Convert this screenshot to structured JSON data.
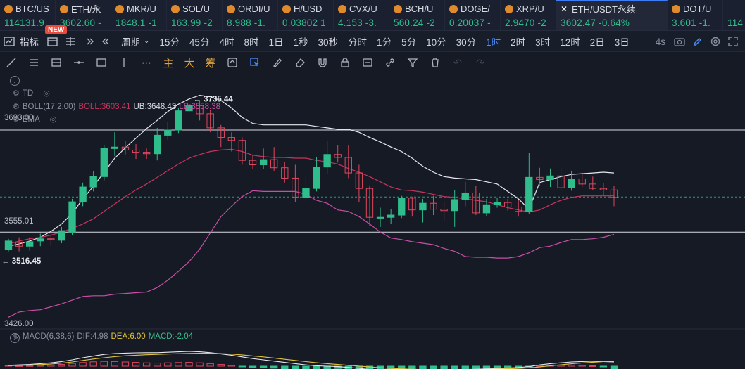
{
  "ticker": [
    {
      "symbol": "BTC/US",
      "price": "114131.9",
      "icon": "coin-icon"
    },
    {
      "symbol": "ETH/永",
      "price": "3602.60 -",
      "icon": "coin-icon"
    },
    {
      "symbol": "MKR/U",
      "price": "1848.1 -1",
      "icon": "coin-icon"
    },
    {
      "symbol": "SOL/U",
      "price": "163.99 -2",
      "icon": "coin-icon"
    },
    {
      "symbol": "ORDI/U",
      "price": "8.988 -1.",
      "icon": "coin-icon"
    },
    {
      "symbol": "H/USD",
      "price": "0.03802 1",
      "icon": "coin-icon"
    },
    {
      "symbol": "CVX/U",
      "price": "4.153 -3.",
      "icon": "coin-icon"
    },
    {
      "symbol": "BCH/U",
      "price": "560.24 -2",
      "icon": "coin-icon"
    },
    {
      "symbol": "DOGE/",
      "price": "0.20037 -",
      "icon": "coin-icon"
    },
    {
      "symbol": "XRP/U",
      "price": "2.9470 -2",
      "icon": "coin-icon"
    },
    {
      "symbol": "ETH/USDT永续",
      "price": "3602.47  -0.64%",
      "icon": "x-logo-icon",
      "active": true
    },
    {
      "symbol": "DOT/U",
      "price": "3.601 -1.",
      "icon": "coin-icon"
    },
    {
      "symbol": "",
      "price": "114",
      "icon": ""
    }
  ],
  "new_badge": "NEW",
  "toolbar": {
    "indicator": "指标",
    "period": "周期",
    "intervals": [
      "15分",
      "45分",
      "4时",
      "8时",
      "1日",
      "1秒",
      "30秒",
      "分时",
      "1分",
      "5分",
      "10分",
      "30分",
      "1时",
      "2时",
      "3时",
      "12时",
      "2日",
      "3日"
    ],
    "selected_interval": "1时",
    "countdown": "4s"
  },
  "drawbar": {
    "cn_tools": [
      "主",
      "大",
      "筹"
    ]
  },
  "legend": {
    "td": "TD",
    "boll_name": "BOLL(17,2.00)",
    "boll": "BOLL:3603.41",
    "ub": "UB:3648.43",
    "lb": "LB:3558.38",
    "ema": "EMA",
    "macd_name": "MACD(6,38,6)",
    "dif": "DIF:4.98",
    "dea": "DEA:6.00",
    "macd": "MACD:-2.04"
  },
  "chart_data": {
    "type": "candlestick",
    "price_labels": {
      "hline_top": "3693.00",
      "hline_bottom": "3555.01",
      "axis_bottom": "3426.00",
      "high": "3735.44",
      "low": "3516.45"
    },
    "ylim": [
      3426,
      3770
    ],
    "hlines": [
      3693.0,
      3555.01
    ],
    "current_price": 3602.47,
    "high_marker": 3735.44,
    "low_marker": 3516.45,
    "candles": [
      [
        3531,
        3543,
        3529,
        3546
      ],
      [
        3541,
        3536,
        3529,
        3548
      ],
      [
        3536,
        3542,
        3530,
        3548
      ],
      [
        3543,
        3546,
        3536,
        3553
      ],
      [
        3546,
        3545,
        3537,
        3556
      ],
      [
        3544,
        3557,
        3540,
        3562
      ],
      [
        3555,
        3596,
        3551,
        3600
      ],
      [
        3596,
        3616,
        3590,
        3622
      ],
      [
        3616,
        3630,
        3610,
        3637
      ],
      [
        3630,
        3668,
        3625,
        3673
      ],
      [
        3668,
        3670,
        3658,
        3690
      ],
      [
        3670,
        3666,
        3660,
        3678
      ],
      [
        3666,
        3663,
        3654,
        3674
      ],
      [
        3663,
        3661,
        3654,
        3668
      ],
      [
        3661,
        3686,
        3652,
        3696
      ],
      [
        3686,
        3693,
        3680,
        3704
      ],
      [
        3693,
        3719,
        3689,
        3723
      ],
      [
        3719,
        3726,
        3707,
        3736
      ],
      [
        3726,
        3715,
        3706,
        3732
      ],
      [
        3715,
        3696,
        3690,
        3720
      ],
      [
        3696,
        3683,
        3670,
        3700
      ],
      [
        3683,
        3679,
        3664,
        3690
      ],
      [
        3679,
        3652,
        3646,
        3683
      ],
      [
        3652,
        3646,
        3640,
        3660
      ],
      [
        3646,
        3653,
        3640,
        3668
      ],
      [
        3653,
        3642,
        3638,
        3670
      ],
      [
        3642,
        3628,
        3622,
        3650
      ],
      [
        3628,
        3602,
        3596,
        3646
      ],
      [
        3602,
        3614,
        3596,
        3632
      ],
      [
        3614,
        3643,
        3610,
        3656
      ],
      [
        3643,
        3660,
        3634,
        3678
      ],
      [
        3660,
        3656,
        3649,
        3673
      ],
      [
        3656,
        3635,
        3628,
        3672
      ],
      [
        3635,
        3614,
        3596,
        3646
      ],
      [
        3614,
        3575,
        3563,
        3618
      ],
      [
        3575,
        3575,
        3562,
        3588
      ],
      [
        3575,
        3578,
        3566,
        3586
      ],
      [
        3578,
        3601,
        3574,
        3604
      ],
      [
        3601,
        3585,
        3576,
        3603
      ],
      [
        3585,
        3594,
        3568,
        3600
      ],
      [
        3594,
        3586,
        3578,
        3604
      ],
      [
        3586,
        3584,
        3570,
        3596
      ],
      [
        3584,
        3599,
        3562,
        3612
      ],
      [
        3599,
        3608,
        3590,
        3623
      ],
      [
        3608,
        3581,
        3578,
        3618
      ],
      [
        3581,
        3592,
        3577,
        3600
      ],
      [
        3592,
        3595,
        3588,
        3602
      ],
      [
        3595,
        3589,
        3584,
        3600
      ],
      [
        3589,
        3583,
        3576,
        3598
      ],
      [
        3583,
        3629,
        3580,
        3662
      ],
      [
        3629,
        3626,
        3618,
        3642
      ],
      [
        3626,
        3631,
        3616,
        3641
      ],
      [
        3631,
        3615,
        3611,
        3642
      ],
      [
        3615,
        3627,
        3611,
        3638
      ],
      [
        3627,
        3620,
        3616,
        3634
      ],
      [
        3620,
        3614,
        3612,
        3630
      ],
      [
        3614,
        3612,
        3604,
        3621
      ],
      [
        3612,
        3602,
        3590,
        3617
      ]
    ],
    "ub_line": [
      3536,
      3539,
      3543,
      3548,
      3556,
      3566,
      3580,
      3600,
      3617,
      3636,
      3655,
      3669,
      3682,
      3695,
      3706,
      3718,
      3728,
      3735,
      3740,
      3738,
      3733,
      3723,
      3710,
      3702,
      3700,
      3700,
      3700,
      3700,
      3700,
      3698,
      3696,
      3694,
      3694,
      3690,
      3683,
      3677,
      3670,
      3664,
      3655,
      3644,
      3636,
      3630,
      3628,
      3627,
      3626,
      3623,
      3620,
      3610,
      3600,
      3586,
      3622,
      3626,
      3630,
      3633,
      3634,
      3635,
      3636,
      3635
    ],
    "mid_line": [
      3539,
      3543,
      3546,
      3548,
      3551,
      3555,
      3560,
      3566,
      3573,
      3583,
      3593,
      3603,
      3612,
      3620,
      3629,
      3638,
      3647,
      3655,
      3660,
      3664,
      3666,
      3667,
      3664,
      3659,
      3657,
      3656,
      3656,
      3655,
      3655,
      3652,
      3650,
      3647,
      3641,
      3636,
      3630,
      3623,
      3616,
      3612,
      3611,
      3609,
      3606,
      3603,
      3602,
      3600,
      3598,
      3596,
      3592,
      3588,
      3585,
      3582,
      3585,
      3592,
      3598,
      3602,
      3604,
      3604,
      3604,
      3604
    ],
    "lb_line": [
      3440,
      3447,
      3449,
      3450,
      3454,
      3458,
      3463,
      3468,
      3469,
      3469,
      3471,
      3472,
      3473,
      3474,
      3480,
      3490,
      3502,
      3515,
      3532,
      3554,
      3576,
      3590,
      3603,
      3611,
      3610,
      3610,
      3610,
      3610,
      3606,
      3598,
      3594,
      3585,
      3583,
      3576,
      3566,
      3555,
      3547,
      3545,
      3542,
      3540,
      3538,
      3533,
      3529,
      3522,
      3521,
      3521,
      3520,
      3520,
      3522,
      3527,
      3534,
      3536,
      3541,
      3545,
      3545,
      3546,
      3548,
      3552
    ],
    "macd_hist": [
      0.5,
      0.3,
      0.4,
      0.6,
      0.8,
      1.2,
      1.9,
      2.6,
      3.1,
      3.4,
      3.3,
      3.0,
      2.7,
      2.4,
      2.2,
      2.4,
      2.6,
      2.7,
      2.4,
      1.8,
      1.2,
      0.6,
      -0.2,
      -0.8,
      -1.2,
      -1.4,
      -1.8,
      -2.6,
      -3.0,
      -2.6,
      -2.0,
      -1.6,
      -1.8,
      -2.4,
      -3.2,
      -3.4,
      -3.0,
      -2.6,
      -2.6,
      -2.4,
      -2.5,
      -2.4,
      -2.2,
      -1.8,
      -2.0,
      -1.9,
      -1.6,
      -1.5,
      -1.4,
      -0.4,
      0.4,
      0.6,
      0.7,
      0.8,
      0.6,
      0.3,
      -0.5,
      -2.04
    ],
    "dif_line": [
      1,
      1.5,
      2,
      3,
      4,
      5.5,
      7.5,
      10,
      12,
      14,
      15,
      15.5,
      15.8,
      16,
      16,
      16.5,
      17,
      17.5,
      17,
      16,
      14.5,
      13,
      11,
      9,
      7.5,
      6,
      4.5,
      3,
      1.5,
      0.5,
      0,
      -0.5,
      -1.5,
      -2.5,
      -4,
      -5,
      -5.5,
      -5.5,
      -5.2,
      -5,
      -4.8,
      -4.6,
      -4.2,
      -3.8,
      -3.6,
      -3.2,
      -2.8,
      -2.2,
      -1.6,
      -0.5,
      1.5,
      3,
      4,
      5,
      5.5,
      5.8,
      5.5,
      4.98
    ],
    "dea_line": [
      0.5,
      0.8,
      1.2,
      1.8,
      2.6,
      3.6,
      5,
      6.8,
      8.5,
      10,
      11.3,
      12.3,
      13,
      13.6,
      14,
      14.4,
      14.8,
      15.2,
      15.4,
      15.3,
      15,
      14.3,
      13.4,
      12.2,
      11,
      9.7,
      8.2,
      6.8,
      5.4,
      4.1,
      3,
      2,
      1,
      0.1,
      -0.9,
      -1.8,
      -2.6,
      -3.2,
      -3.6,
      -3.9,
      -4.1,
      -4.2,
      -4.2,
      -4.1,
      -4,
      -3.8,
      -3.5,
      -3.1,
      -2.6,
      -1.9,
      -0.9,
      0.4,
      1.6,
      2.8,
      3.8,
      4.7,
      5.4,
      6.0
    ]
  }
}
